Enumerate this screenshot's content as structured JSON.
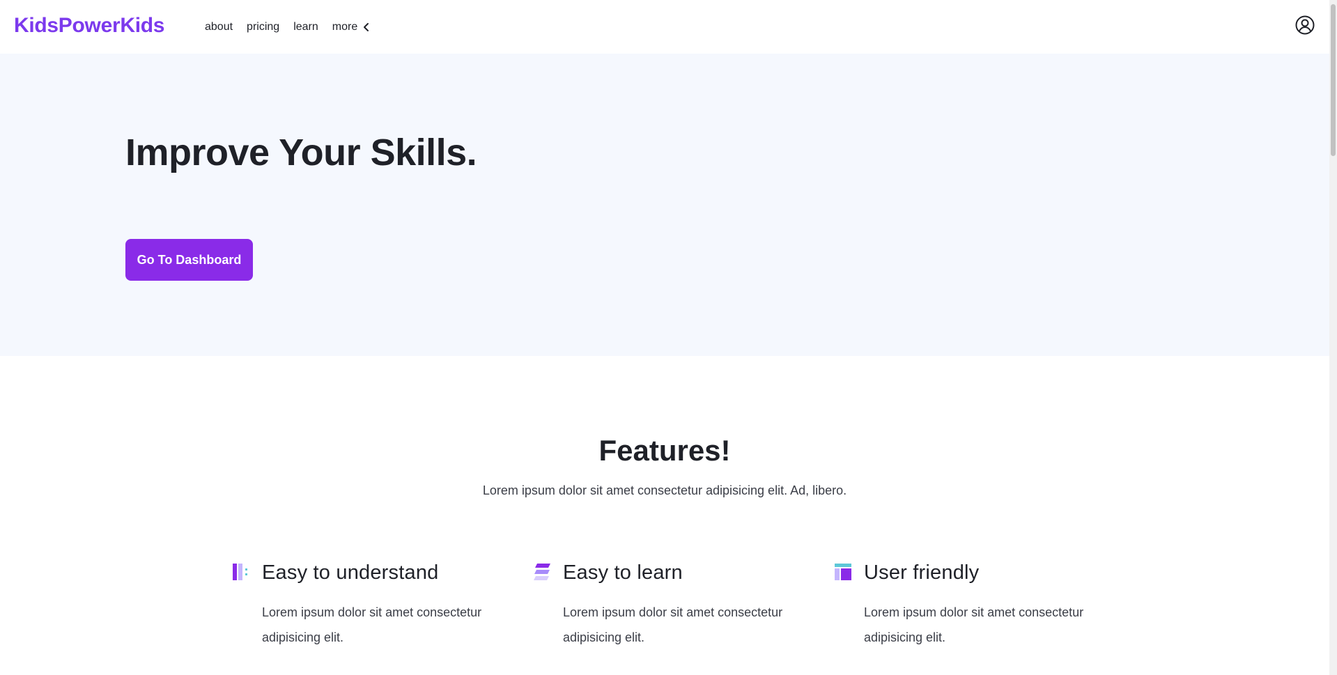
{
  "brand": "KidsPowerKids",
  "nav": {
    "items": [
      {
        "label": "about"
      },
      {
        "label": "pricing"
      },
      {
        "label": "learn"
      },
      {
        "label": "more"
      }
    ]
  },
  "hero": {
    "title": "Improve Your Skills.",
    "cta_label": "Go To Dashboard"
  },
  "features": {
    "title": "Features!",
    "subtitle": "Lorem ipsum dolor sit amet consectetur adipisicing elit. Ad, libero.",
    "items": [
      {
        "icon": "layout-columns-icon",
        "title": "Easy to understand",
        "text": "Lorem ipsum dolor sit amet consectetur adipisicing elit."
      },
      {
        "icon": "stack-layers-icon",
        "title": "Easy to learn",
        "text": "Lorem ipsum dolor sit amet consectetur adipisicing elit."
      },
      {
        "icon": "layout-panel-icon",
        "title": "User friendly",
        "text": "Lorem ipsum dolor sit amet consectetur adipisicing elit."
      }
    ]
  },
  "colors": {
    "brand": "#7c3aed",
    "button": "#8a2be8",
    "hero_bg": "#f5f8fe",
    "icon_teal": "#5ec8d8",
    "icon_lavender": "#c4b5fd"
  }
}
